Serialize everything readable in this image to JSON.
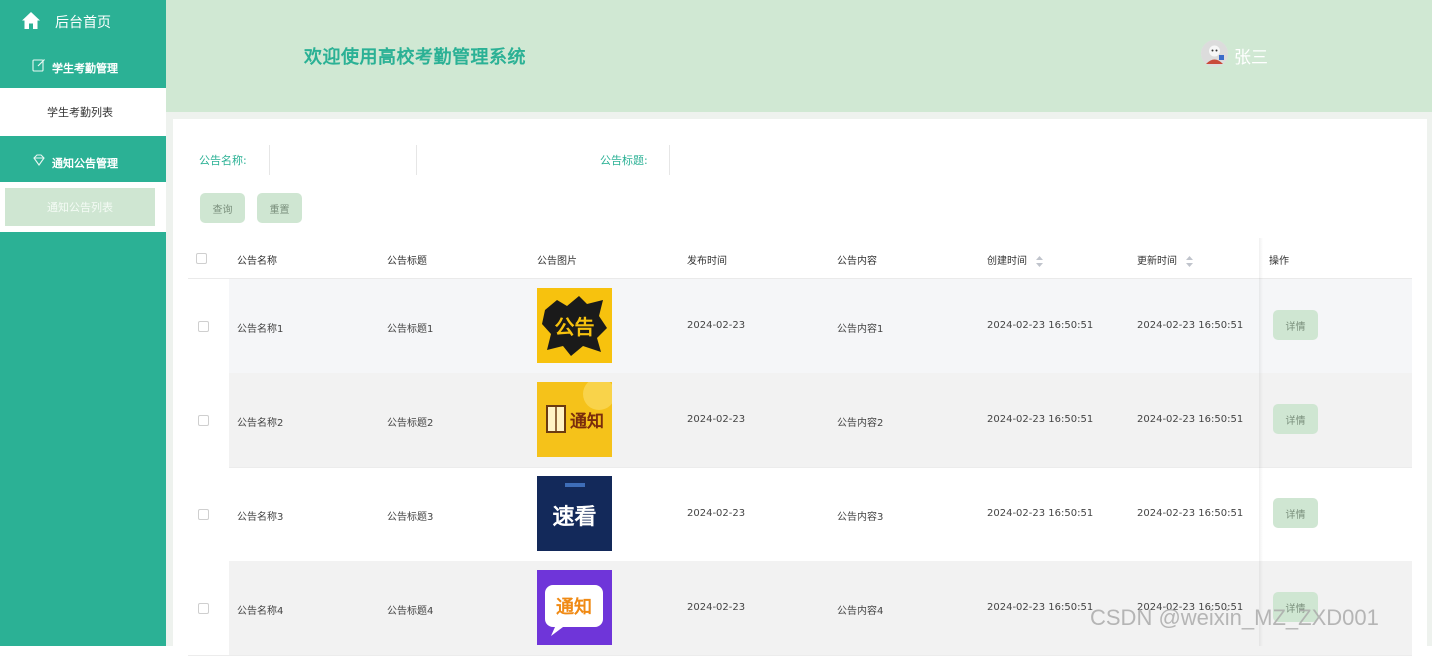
{
  "sidebar": {
    "home_label": "后台首页",
    "groups": [
      {
        "label": "学生考勤管理",
        "items": [
          {
            "label": "学生考勤列表",
            "active": false
          }
        ]
      },
      {
        "label": "通知公告管理",
        "items": [
          {
            "label": "通知公告列表",
            "active": true
          }
        ]
      }
    ],
    "bg_color": "#2bb195"
  },
  "header": {
    "title": "欢迎使用高校考勤管理系统",
    "username": "张三"
  },
  "search": {
    "name_label": "公告名称:",
    "title_label": "公告标题:",
    "query_button": "查询",
    "reset_button": "重置"
  },
  "table": {
    "columns": [
      "公告名称",
      "公告标题",
      "公告图片",
      "发布时间",
      "公告内容",
      "创建时间",
      "更新时间",
      "操作"
    ],
    "rows": [
      {
        "name": "公告名称1",
        "title": "公告标题1",
        "image_text": "公告",
        "publish": "2024-02-23",
        "content": "公告内容1",
        "created": "2024-02-23 16:50:51",
        "updated": "2024-02-23 16:50:51",
        "action": "详情"
      },
      {
        "name": "公告名称2",
        "title": "公告标题2",
        "image_text": "通知",
        "publish": "2024-02-23",
        "content": "公告内容2",
        "created": "2024-02-23 16:50:51",
        "updated": "2024-02-23 16:50:51",
        "action": "详情"
      },
      {
        "name": "公告名称3",
        "title": "公告标题3",
        "image_text": "速看",
        "publish": "2024-02-23",
        "content": "公告内容3",
        "created": "2024-02-23 16:50:51",
        "updated": "2024-02-23 16:50:51",
        "action": "详情"
      },
      {
        "name": "公告名称4",
        "title": "公告标题4",
        "image_text": "通知",
        "publish": "2024-02-23",
        "content": "公告内容4",
        "created": "2024-02-23 16:50:51",
        "updated": "2024-02-23 16:50:51",
        "action": "详情"
      }
    ]
  },
  "watermark": "CSDN @weixin_MZ_ZXD001"
}
